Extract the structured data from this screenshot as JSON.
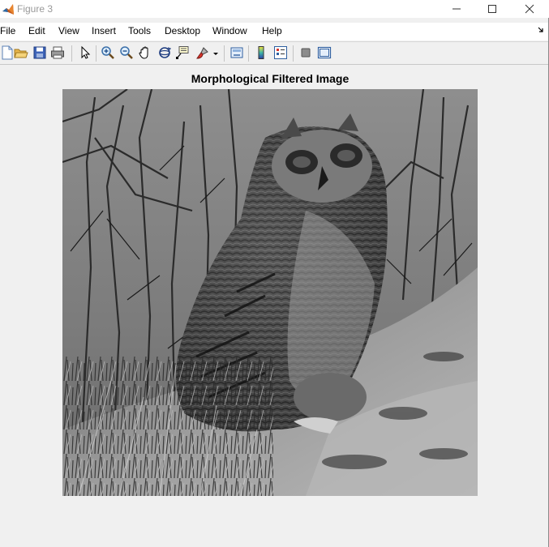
{
  "window": {
    "title": "Figure 3"
  },
  "menu": {
    "items": [
      "File",
      "Edit",
      "View",
      "Insert",
      "Tools",
      "Desktop",
      "Window",
      "Help"
    ]
  },
  "toolbar": {
    "buttons": [
      "new-figure-icon",
      "open-file-icon",
      "save-icon",
      "print-icon",
      "pointer-icon",
      "zoom-in-icon",
      "zoom-out-icon",
      "pan-icon",
      "rotate-3d-icon",
      "data-cursor-icon",
      "brush-icon",
      "link-plot-icon",
      "colorbar-icon",
      "legend-icon",
      "hide-plot-tools-icon",
      "show-plot-tools-icon"
    ]
  },
  "axes": {
    "title": "Morphological Filtered Image"
  },
  "colors": {
    "background": "#f0f0f0",
    "title_text": "#999999"
  }
}
